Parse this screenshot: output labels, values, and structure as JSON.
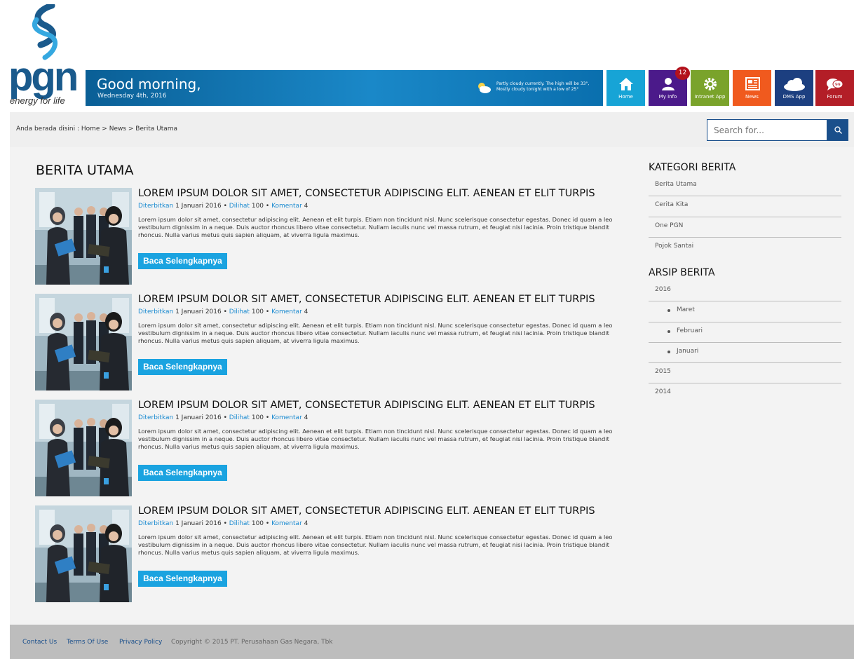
{
  "brand": {
    "name": "pgn",
    "tagline": "energy for life"
  },
  "greeting": {
    "title": "Good morning,",
    "date": "Wednesday 4th, 2016"
  },
  "weather": {
    "icon": "partly-cloudy-icon",
    "text": "Partly cloudy currently. The high will be 33°, Mostly cloudy tonight with a low of 25°"
  },
  "tiles": [
    {
      "label": "Home",
      "icon": "home-icon",
      "color": "#17a4d6"
    },
    {
      "label": "My Info",
      "icon": "user-icon",
      "color": "#4b1a8a"
    },
    {
      "label": "Intranet App",
      "icon": "gear-icon",
      "color": "#7aa32b"
    },
    {
      "label": "News",
      "icon": "newspaper-icon",
      "color": "#f05a1e"
    },
    {
      "label": "DMS App",
      "icon": "cloud-icon",
      "color": "#1c3f80"
    },
    {
      "label": "Forum",
      "icon": "chat-icon",
      "color": "#b31e27"
    }
  ],
  "notification_count": "12",
  "breadcrumb": "Anda berada disini : Home > News > Berita Utama",
  "search": {
    "placeholder": "Search for..."
  },
  "page_title": "BERITA UTAMA",
  "articles": [
    {
      "title": "LOREM IPSUM DOLOR SIT AMET, CONSECTETUR ADIPISCING ELIT. AENEAN ET ELIT TURPIS",
      "meta": {
        "published_label": "Diterbitkan",
        "date": "1 Januari 2016",
        "views_label": "Dilihat",
        "views": "100",
        "comments_label": "Komentar",
        "comments": "4"
      },
      "body": "Lorem ipsum dolor sit amet, consectetur adipiscing elit. Aenean et elit turpis. Etiam non tincidunt nisl. Nunc scelerisque consectetur egestas. Donec id quam a leo vestibulum dignissim in a neque. Duis auctor rhoncus libero vitae consectetur. Nullam iaculis nunc vel massa rutrum, et feugiat nisi lacinia. Proin tristique blandit rhoncus. Nulla varius metus quis sapien aliquam, at viverra ligula maximus.",
      "button": "Baca Selengkapnya"
    },
    {
      "title": "LOREM IPSUM DOLOR SIT AMET, CONSECTETUR ADIPISCING ELIT. AENEAN ET ELIT TURPIS",
      "meta": {
        "published_label": "Diterbitkan",
        "date": "1 Januari 2016",
        "views_label": "Dilihat",
        "views": "100",
        "comments_label": "Komentar",
        "comments": "4"
      },
      "body": "Lorem ipsum dolor sit amet, consectetur adipiscing elit. Aenean et elit turpis. Etiam non tincidunt nisl. Nunc scelerisque consectetur egestas. Donec id quam a leo vestibulum dignissim in a neque. Duis auctor rhoncus libero vitae consectetur. Nullam iaculis nunc vel massa rutrum, et feugiat nisi lacinia. Proin tristique blandit rhoncus. Nulla varius metus quis sapien aliquam, at viverra ligula maximus.",
      "button": "Baca Selengkapnya"
    },
    {
      "title": "LOREM IPSUM DOLOR SIT AMET, CONSECTETUR ADIPISCING ELIT. AENEAN ET ELIT TURPIS",
      "meta": {
        "published_label": "Diterbitkan",
        "date": "1 Januari 2016",
        "views_label": "Dilihat",
        "views": "100",
        "comments_label": "Komentar",
        "comments": "4"
      },
      "body": "Lorem ipsum dolor sit amet, consectetur adipiscing elit. Aenean et elit turpis. Etiam non tincidunt nisl. Nunc scelerisque consectetur egestas. Donec id quam a leo vestibulum dignissim in a neque. Duis auctor rhoncus libero vitae consectetur. Nullam iaculis nunc vel massa rutrum, et feugiat nisi lacinia. Proin tristique blandit rhoncus. Nulla varius metus quis sapien aliquam, at viverra ligula maximus.",
      "button": "Baca Selengkapnya"
    },
    {
      "title": "LOREM IPSUM DOLOR SIT AMET, CONSECTETUR ADIPISCING ELIT. AENEAN ET ELIT TURPIS",
      "meta": {
        "published_label": "Diterbitkan",
        "date": "1 Januari 2016",
        "views_label": "Dilihat",
        "views": "100",
        "comments_label": "Komentar",
        "comments": "4"
      },
      "body": "Lorem ipsum dolor sit amet, consectetur adipiscing elit. Aenean et elit turpis. Etiam non tincidunt nisl. Nunc scelerisque consectetur egestas. Donec id quam a leo vestibulum dignissim in a neque. Duis auctor rhoncus libero vitae consectetur. Nullam iaculis nunc vel massa rutrum, et feugiat nisi lacinia. Proin tristique blandit rhoncus. Nulla varius metus quis sapien aliquam, at viverra ligula maximus.",
      "button": "Baca Selengkapnya"
    }
  ],
  "sidebar": {
    "categories_title": "KATEGORI BERITA",
    "categories": [
      "Berita Utama",
      "Cerita Kita",
      "One PGN",
      "Pojok Santai"
    ],
    "archive_title": "ARSIP BERITA",
    "archive": [
      {
        "label": "2016",
        "sub": false
      },
      {
        "label": "Maret",
        "sub": true
      },
      {
        "label": "Februari",
        "sub": true
      },
      {
        "label": "Januari",
        "sub": true
      },
      {
        "label": "2015",
        "sub": false
      },
      {
        "label": "2014",
        "sub": false
      }
    ]
  },
  "footer": {
    "contact": "Contact Us",
    "terms": "Terms Of Use",
    "privacy": "Privacy Policy",
    "copyright": "Copyright © 2015 PT. Perusahaan Gas Negara, Tbk"
  }
}
